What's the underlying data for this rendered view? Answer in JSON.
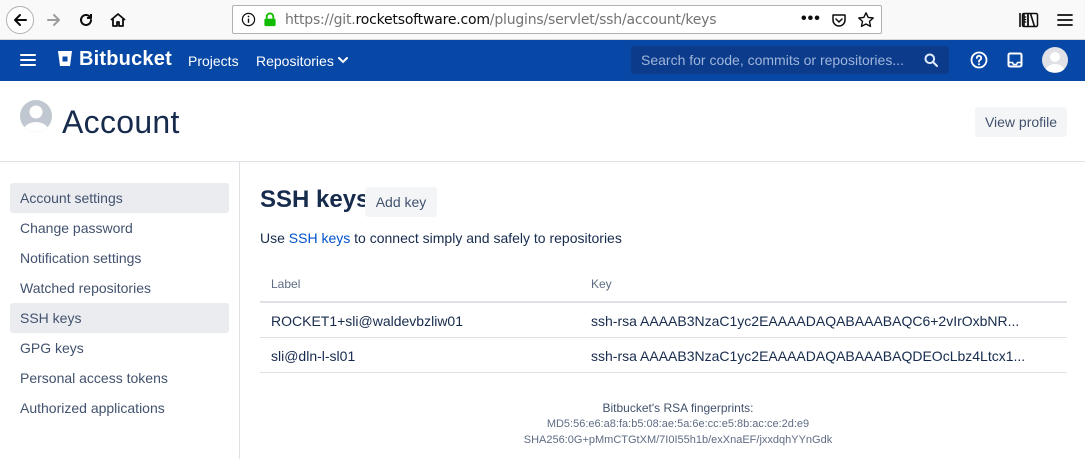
{
  "browser": {
    "url_prefix": "https://git.",
    "url_host": "rocketsoftware.com",
    "url_path": "/plugins/servlet/ssh/account/keys",
    "url_dots": "•••"
  },
  "header": {
    "brand": "Bitbucket",
    "nav": {
      "projects": "Projects",
      "repositories": "Repositories"
    },
    "search_placeholder": "Search for code, commits or repositories...",
    "accent_color": "#0747a6"
  },
  "page": {
    "title": "Account",
    "view_profile": "View profile"
  },
  "sidebar": {
    "items": [
      {
        "label": "Account settings",
        "selected": true
      },
      {
        "label": "Change password",
        "selected": false
      },
      {
        "label": "Notification settings",
        "selected": false
      },
      {
        "label": "Watched repositories",
        "selected": false
      },
      {
        "label": "SSH keys",
        "selected": true
      },
      {
        "label": "GPG keys",
        "selected": false
      },
      {
        "label": "Personal access tokens",
        "selected": false
      },
      {
        "label": "Authorized applications",
        "selected": false
      }
    ]
  },
  "main": {
    "title": "SSH keys",
    "add_key": "Add key",
    "intro_before": "Use ",
    "intro_link": "SSH keys",
    "intro_after": " to connect simply and safely to repositories",
    "columns": {
      "label": "Label",
      "key": "Key"
    },
    "rows": [
      {
        "label": "ROCKET1+sli@waldevbzliw01",
        "key": "ssh-rsa AAAAB3NzaC1yc2EAAAADAQABAAABAQC6+2vIrOxbNR..."
      },
      {
        "label": "sli@dln-l-sl01",
        "key": "ssh-rsa AAAAB3NzaC1yc2EAAAADAQABAAABAQDEOcLbz4Ltcx1..."
      }
    ],
    "fingerprints": {
      "title": "Bitbucket's RSA fingerprints:",
      "md5": "MD5:56:e6:a8:fa:b5:08:ae:5a:6e:cc:e5:8b:ac:ce:2d:e9",
      "sha256": "SHA256:0G+pMmCTGtXM/7I0I55h1b/exXnaEF/jxxdqhYYnGdk"
    }
  }
}
